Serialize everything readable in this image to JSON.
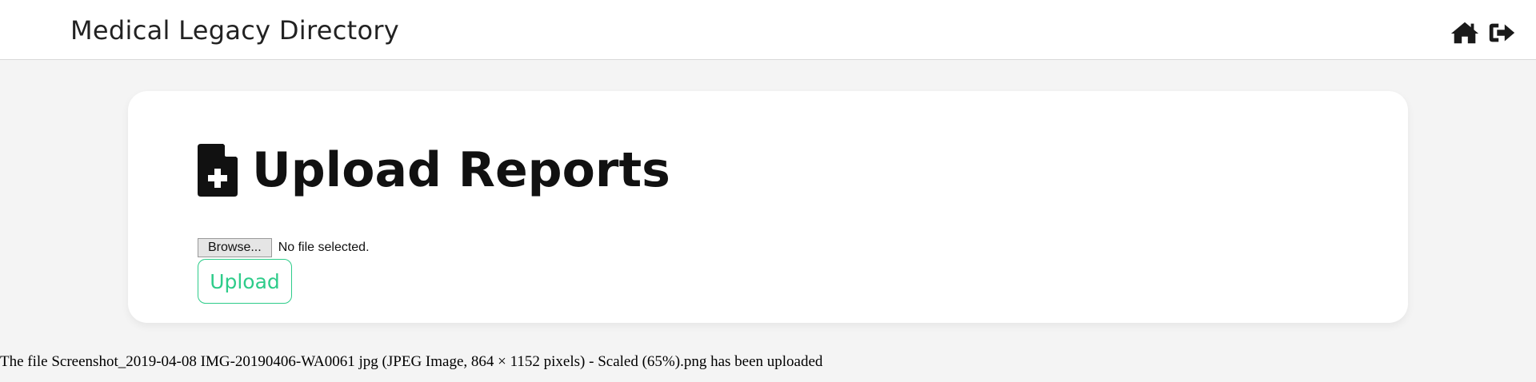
{
  "header": {
    "title": "Medical Legacy Directory",
    "icons": [
      "home-icon",
      "sign-out-icon"
    ]
  },
  "card": {
    "heading_icon": "file-medical-icon",
    "title": "Upload Reports",
    "file_input": {
      "browse_label": "Browse...",
      "status": "No file selected."
    },
    "upload_label": "Upload"
  },
  "status_message": "The file Screenshot_2019-04-08 IMG-20190406-WA0061 jpg (JPEG Image, 864 × 1152 pixels) - Scaled (65%).png has been uploaded",
  "colors": {
    "accent": "#2ecc8a",
    "background": "#f4f4f4",
    "card": "#ffffff",
    "icon": "#1a1a1a"
  }
}
